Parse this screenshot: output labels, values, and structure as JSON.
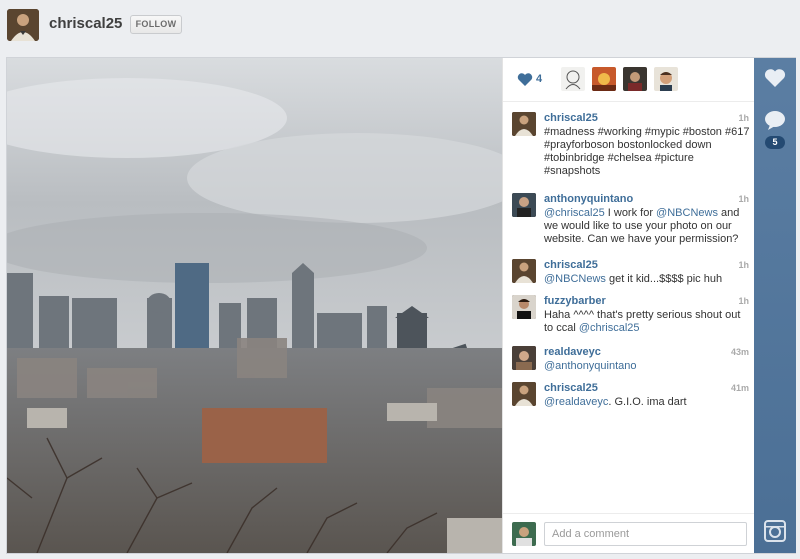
{
  "header": {
    "username": "chriscal25",
    "follow_label": "FOLLOW"
  },
  "likes": {
    "count": "4"
  },
  "comments": [
    {
      "author": "chriscal25",
      "time": "1h",
      "parts": [
        {
          "t": "#madness #working #mypic #boston #617 #prayforboson bostonlocked down #tobinbridge #chelsea #picture #snapshots",
          "tag": false
        }
      ]
    },
    {
      "author": "anthonyquintano",
      "time": "1h",
      "parts": [
        {
          "t": "@chriscal25",
          "tag": true
        },
        {
          "t": " I work for ",
          "tag": false
        },
        {
          "t": "@NBCNews",
          "tag": true
        },
        {
          "t": " and we would like to use your photo on our website. Can we have your permission?",
          "tag": false
        }
      ]
    },
    {
      "author": "chriscal25",
      "time": "1h",
      "parts": [
        {
          "t": "@NBCNews",
          "tag": true
        },
        {
          "t": " get it kid...$$$$ pic huh",
          "tag": false
        }
      ]
    },
    {
      "author": "fuzzybarber",
      "time": "1h",
      "parts": [
        {
          "t": "Haha ^^^^ that's pretty serious shout out to ccal ",
          "tag": false
        },
        {
          "t": "@chriscal25",
          "tag": true
        }
      ]
    },
    {
      "author": "realdaveyc",
      "time": "43m",
      "parts": [
        {
          "t": "@anthonyquintano",
          "tag": true
        }
      ]
    },
    {
      "author": "chriscal25",
      "time": "41m",
      "parts": [
        {
          "t": "@realdaveyc",
          "tag": true
        },
        {
          "t": ". G.I.O. ima dart",
          "tag": false
        }
      ]
    }
  ],
  "comment_input": {
    "placeholder": "Add a comment"
  },
  "rail": {
    "comment_count": "5"
  },
  "colors": {
    "link": "#3f6e99",
    "rail": "#5b7ea3",
    "badge": "#244a72"
  }
}
